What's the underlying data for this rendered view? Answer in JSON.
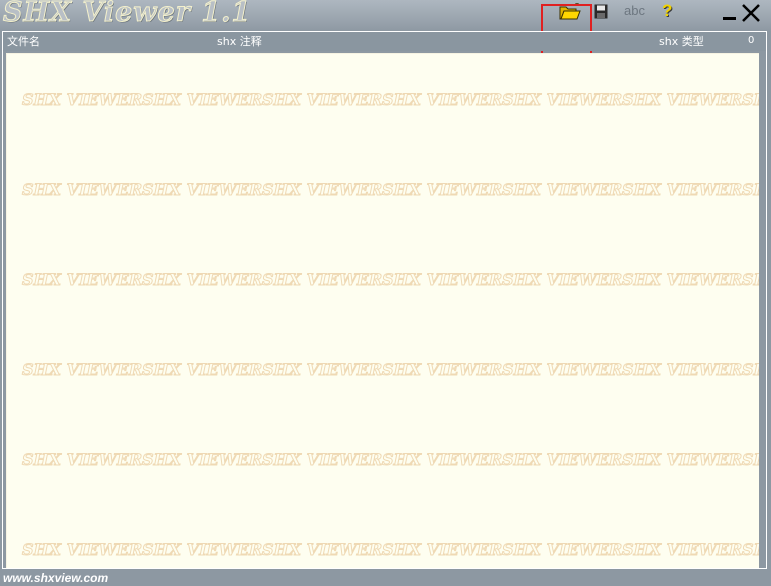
{
  "app": {
    "title": "SHX Viewer 1.1"
  },
  "toolbar": {
    "open_icon": "folder-open-icon",
    "save_icon": "floppy-disk-icon",
    "abc_label": "abc",
    "help_label": "?",
    "minimize_icon": "minimize-icon",
    "close_icon": "close-icon"
  },
  "list_header": {
    "filename": "文件名",
    "comment": "shx 注释",
    "type": "shx 类型",
    "count": "0"
  },
  "watermark": {
    "text": "SHX VIEWER"
  },
  "footer": {
    "url": "www.shxview.com"
  },
  "colors": {
    "chrome": "#8d98a2",
    "list_background": "#fefef0",
    "watermark_outline": "#efd9b4",
    "highlight": "#e02020"
  }
}
